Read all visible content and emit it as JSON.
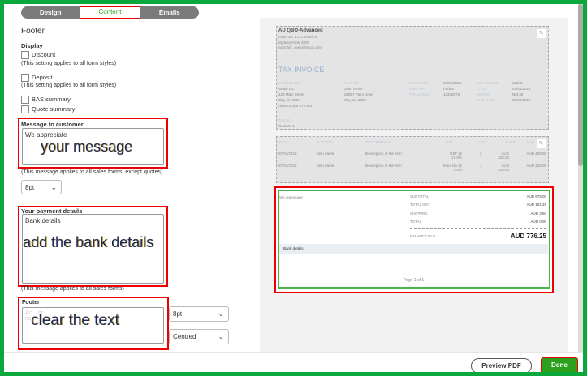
{
  "tabs": [
    {
      "label": "Design"
    },
    {
      "label": "Content"
    },
    {
      "label": "Emails"
    }
  ],
  "section_title": "Footer",
  "display": {
    "heading": "Display",
    "discount": "Discount",
    "deposit": "Deposit",
    "note": "(This setting applies to all form styles)",
    "bas": "BAS summary",
    "quote": "Quote summary"
  },
  "message": {
    "label": "Message to customer",
    "value": "We appreciate",
    "annotation": "your message",
    "note": "(This message applies to all sales forms, except quotes)",
    "font_size": "8pt"
  },
  "payment": {
    "label": "Your payment details",
    "value": "Bank details",
    "annotation": "add the bank details",
    "note": "(This message applies to all sales forms)"
  },
  "footer": {
    "label": "Footer",
    "placeholder": "Ac... or ne...",
    "annotation": "clear the text",
    "font_size": "8pt",
    "alignment": "Centred"
  },
  "preview": {
    "company": "AU QBO-Advanced",
    "address": [
      "Level 34, 1 O'Connell St",
      "Sydney NSW 2000",
      "noyichrk_aveo@intuit.com"
    ],
    "doc_title": "TAX INVOICE",
    "invoice_to_label": "INVOICE TO",
    "invoice_to": [
      "Smith Co.",
      "123 Main Street",
      "City, SA 1234",
      "ABN 12 345 678 901"
    ],
    "ship_to_label": "SHIP TO",
    "ship_to": [
      "John Smith",
      "20857 Palm Drive",
      "City, SA 1234"
    ],
    "ship_labels": [
      "SHIP DATE",
      "SHIP VIA",
      "TRACKING#"
    ],
    "ship_values": [
      "03/01/2018",
      "FedEx",
      "12345678"
    ],
    "inv_labels": [
      "TAX INVOICE",
      "DATE",
      "TERMS",
      "DUE DATE"
    ],
    "inv_values": [
      "12345",
      "07/01/2018",
      "Net 30",
      "08/02/2018"
    ],
    "tax_id_label": "TAX ID",
    "tax_id": "Custom-1",
    "columns": [
      "DATE",
      "ACTIVITY",
      "DESCRIPTION",
      "GST",
      "QTY",
      "RATE",
      "AMO"
    ],
    "rows": [
      [
        "07/01/2018",
        "Item name",
        "Description of the item",
        "GST @ 10.0%",
        "2",
        "AUD 225.00",
        "AUD 450.00"
      ],
      [
        "07/01/2018",
        "Item name",
        "Description of the item",
        "Input tax @ 0.0%",
        "1",
        "AUD 225.00",
        "AUD 225.00"
      ]
    ],
    "message": "We appreciate",
    "totals": [
      [
        "SUBTOTAL",
        "AUD 675.00"
      ],
      [
        "TOTAL GST",
        "AUD 101.25"
      ],
      [
        "SHIPPING",
        "AUD 3.50"
      ],
      [
        "TOTAL",
        "AUD 0.00"
      ]
    ],
    "balance_label": "BALANCE DUE",
    "balance": "AUD 776.25",
    "bank": "Bank details",
    "page": "Page 1 of 1"
  },
  "buttons": {
    "preview_pdf": "Preview PDF",
    "done": "Done"
  }
}
